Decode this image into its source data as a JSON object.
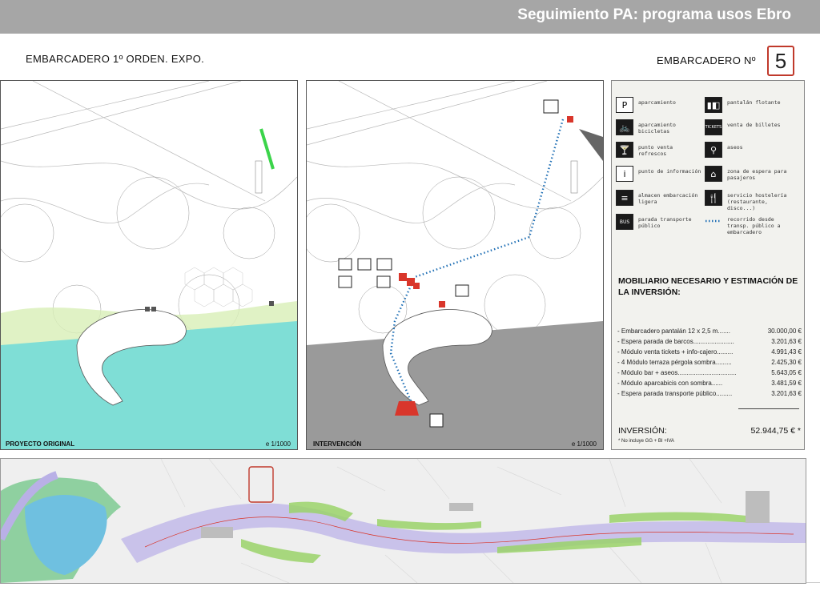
{
  "header": {
    "title": "Seguimiento PA: programa usos Ebro"
  },
  "sheet": {
    "left_title": "EMBARCADERO 1º ORDEN.   EXPO.",
    "right_title": "EMBARCADERO Nº",
    "number": "5"
  },
  "panel_original": {
    "caption": "PROYECTO ORIGINAL",
    "scale": "e  1/1000"
  },
  "panel_intervention": {
    "caption": "INTERVENCIÓN",
    "scale": "e  1/1000"
  },
  "legend": {
    "items": [
      {
        "icon": "P",
        "label": "aparcamiento"
      },
      {
        "icon": "▮◧",
        "label": "pantalán flotante"
      },
      {
        "icon": "🚲",
        "label": "aparcamiento bicicletas"
      },
      {
        "icon": "TICKETS",
        "label": "venta de billetes"
      },
      {
        "icon": "🍸",
        "label": "punto venta refrescos"
      },
      {
        "icon": "⚲",
        "label": "aseos"
      },
      {
        "icon": "i",
        "label": "punto de información"
      },
      {
        "icon": "⌂",
        "label": "zona de espera para pasajeros"
      },
      {
        "icon": "≡",
        "label": "almacen embarcación ligera"
      },
      {
        "icon": "🍴",
        "label": "servicio hostelería (restaurante, disco...)"
      },
      {
        "icon": "BUS",
        "label": "parada transporte público"
      },
      {
        "icon": "dots",
        "label": "recorrido desde transp. público a embarcadero"
      }
    ]
  },
  "investment": {
    "title": "MOBILIARIO NECESARIO Y ESTIMACIÓN DE LA INVERSIÓN:",
    "rows": [
      {
        "label": "- Embarcadero pantalán  12 x 2,5 m.......",
        "amount": "30.000,00 €"
      },
      {
        "label": "- Espera parada de barcos.......................",
        "amount": "3.201,63 €"
      },
      {
        "label": "- Módulo venta tickets + info-cajero.........",
        "amount": "4.991,43 €"
      },
      {
        "label": "- 4 Módulo terraza pérgola sombra.........",
        "amount": "2.425,30 €"
      },
      {
        "label": "- Módulo bar + aseos.................................",
        "amount": "5.643,05 €"
      },
      {
        "label": "- Módulo aparcabicis con sombra......",
        "amount": "3.481,59 €"
      },
      {
        "label": "- Espera parada transporte público.........",
        "amount": "3.201,63 €"
      }
    ],
    "total_label": "INVERSIÓN:",
    "total_amount": "52.944,75 € *",
    "note": "* No incluye GG + BI +IVA"
  },
  "colors": {
    "water_original": "#7fded6",
    "water_intervention": "#9a9a9a",
    "route_dots": "#1f6fb5",
    "intervention_red": "#d9362b",
    "highlight_box": "#c0392b",
    "river": "#c9c2ea"
  }
}
